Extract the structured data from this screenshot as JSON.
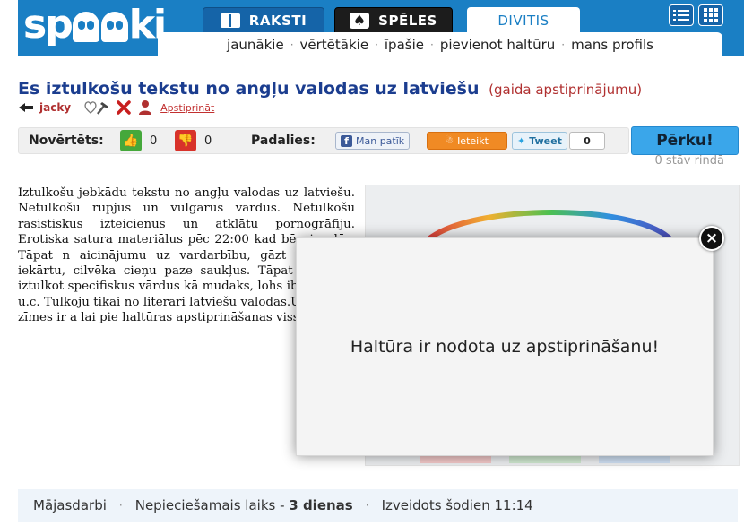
{
  "header": {
    "logo": "spooki",
    "tabs": [
      {
        "label": "RAKSTI",
        "icon": "book-icon"
      },
      {
        "label": "SPĒLES",
        "icon": "spade-icon"
      },
      {
        "label": "DIVITIS"
      }
    ],
    "corner_buttons": [
      "list-view-icon",
      "grid-view-icon"
    ],
    "subnav": [
      "jaunākie",
      "vērtētākie",
      "īpašie",
      "pievienot haltūru",
      "mans profils"
    ],
    "subnav_separator": "·"
  },
  "post": {
    "title": "Es iztulkošu tekstu no angļu valodas uz latviešu",
    "status": "(gaida apstiprinājumu)",
    "author": "jacky",
    "approve_link": "Apstiprināt"
  },
  "rating": {
    "rated_label": "Novērtēts:",
    "likes": "0",
    "dislikes": "0",
    "share_label": "Padalies:",
    "fb_label": "Man patīk",
    "ieteikt_label": "Ieteikt",
    "tweet_label": "Tweet",
    "tweet_count": "0"
  },
  "buy": {
    "label": "Pērku!",
    "queue": "0 stāv rindā"
  },
  "body_text": "Iztulkošu jebkādu tekstu no angļu valodas uz latviešu. Netulkošu rupjus un vulgārus vārdus. Netulkošu rasistiskus izteicienus un atklātu pornogrāfiju. Erotiska satura materiālus pēc 22:00 kad bērni gulēs. Tāpat n aicinājumu uz vardarbību, gāzt pa valsts iekārtu, cilvēka cieņu paze saukļus. Tāpat neņemos iztulkot specifiskus vārdus kā mudaks, lohs ibitītrasasā u.c. Tulkoju tikai no literāri latviešu valodas.Un tā, 450 zīmes ir a lai pie haltūras apstiprināšanas viss not",
  "modal": {
    "message": "Haltūra ir nodota uz apstiprināšanu!",
    "close": "×"
  },
  "footer": {
    "category": "Mājasdarbi",
    "time_label": "Nepieciešamais laiks -",
    "time_value": "3 dienas",
    "created": "Izveidots šodien 11:14",
    "separator": "·"
  }
}
